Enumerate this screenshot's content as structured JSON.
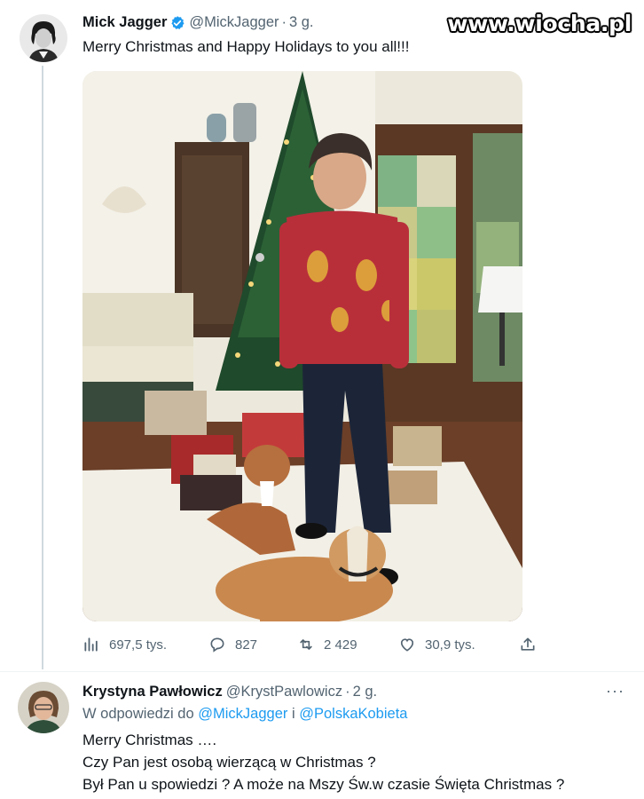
{
  "watermark": "www.wiocha.pl",
  "tweet": {
    "display_name": "Mick Jagger",
    "handle": "@MickJagger",
    "separator": "·",
    "time": "3 g.",
    "text": "Merry Christmas and Happy Holidays to you all!!!",
    "stats": {
      "views": "697,5 tys.",
      "replies": "827",
      "retweets": "2 429",
      "likes": "30,9 tys."
    }
  },
  "reply": {
    "display_name": "Krystyna Pawłowicz",
    "handle": "@KrystPawlowicz",
    "separator": "·",
    "time": "2 g.",
    "replying_prefix": "W odpowiedzi do ",
    "mention1": "@MickJagger",
    "conj": " i ",
    "mention2": "@PolskaKobieta",
    "lines": [
      "Merry Christmas ….",
      "Czy Pan jest osobą wierzącą w Christmas ?",
      "Był Pan u spowiedzi ? A może na Mszy Św.w czasie Święta Christmas ?"
    ],
    "more_label": "···"
  },
  "colors": {
    "link": "#1d9bf0",
    "secondary_text": "#536471",
    "verified": "#1d9bf0"
  },
  "icons": {
    "views": "bar-chart-icon",
    "reply": "speech-bubble-icon",
    "retweet": "retweet-arrows-icon",
    "like": "heart-icon",
    "share": "share-upload-icon"
  }
}
